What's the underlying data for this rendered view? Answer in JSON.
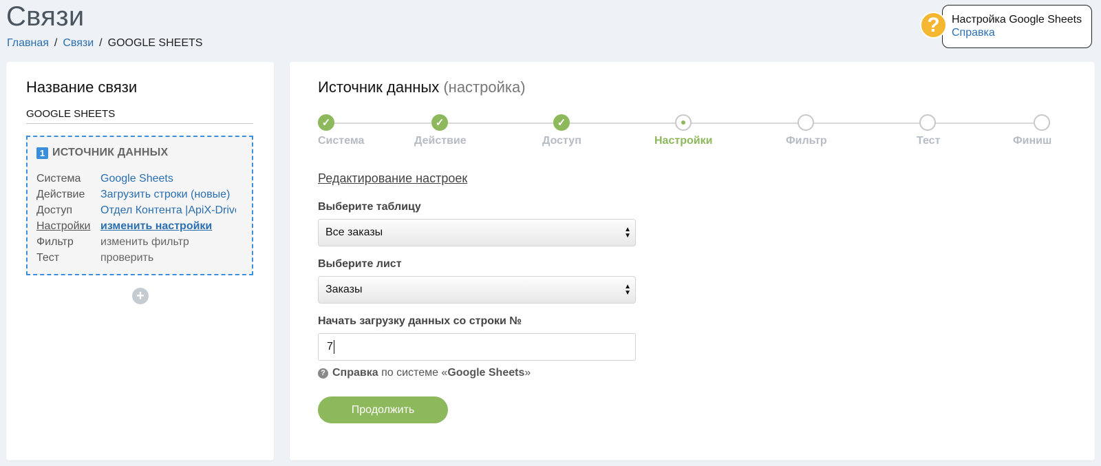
{
  "page": {
    "title": "Связи"
  },
  "breadcrumb": {
    "home": "Главная",
    "links": "Связи",
    "current": "GOOGLE SHEETS",
    "separator": "/"
  },
  "help_widget": {
    "badge": "?",
    "title": "Настройка Google Sheets",
    "link": "Справка"
  },
  "left_panel": {
    "title": "Название связи",
    "connection_name": "GOOGLE SHEETS",
    "source": {
      "number": "1",
      "heading": "ИСТОЧНИК ДАННЫХ",
      "rows": [
        {
          "key": "Система",
          "value": "Google Sheets"
        },
        {
          "key": "Действие",
          "value": "Загрузить строки (новые)"
        },
        {
          "key": "Доступ",
          "value": "Отдел Контента |ApiX-Drive"
        },
        {
          "key": "Настройки",
          "value": "изменить настройки"
        },
        {
          "key": "Фильтр",
          "value": "изменить фильтр"
        },
        {
          "key": "Тест",
          "value": "проверить"
        }
      ]
    },
    "add_button": "+"
  },
  "main": {
    "title": "Источник данных",
    "title_sub": "(настройка)",
    "steps": [
      {
        "label": "Система",
        "state": "done"
      },
      {
        "label": "Действие",
        "state": "done"
      },
      {
        "label": "Доступ",
        "state": "done"
      },
      {
        "label": "Настройки",
        "state": "current"
      },
      {
        "label": "Фильтр",
        "state": "todo"
      },
      {
        "label": "Тест",
        "state": "todo"
      },
      {
        "label": "Финиш",
        "state": "todo"
      }
    ],
    "check_glyph": "✓",
    "section_title": "Редактирование настроек",
    "table_label": "Выберите таблицу",
    "table_value": "Все заказы",
    "sheet_label": "Выберите лист",
    "sheet_value": "Заказы",
    "row_label": "Начать загрузку данных со строки №",
    "row_value": "7",
    "help_prefix": "Справка",
    "help_middle": "по системе «",
    "help_system": "Google Sheets",
    "help_suffix": "»",
    "help_icon": "?",
    "continue_label": "Продолжить"
  },
  "colors": {
    "accent_green": "#8db85c",
    "link_blue": "#2a6fb0",
    "help_yellow": "#f5b731",
    "dashed_blue": "#3a8fdc"
  }
}
